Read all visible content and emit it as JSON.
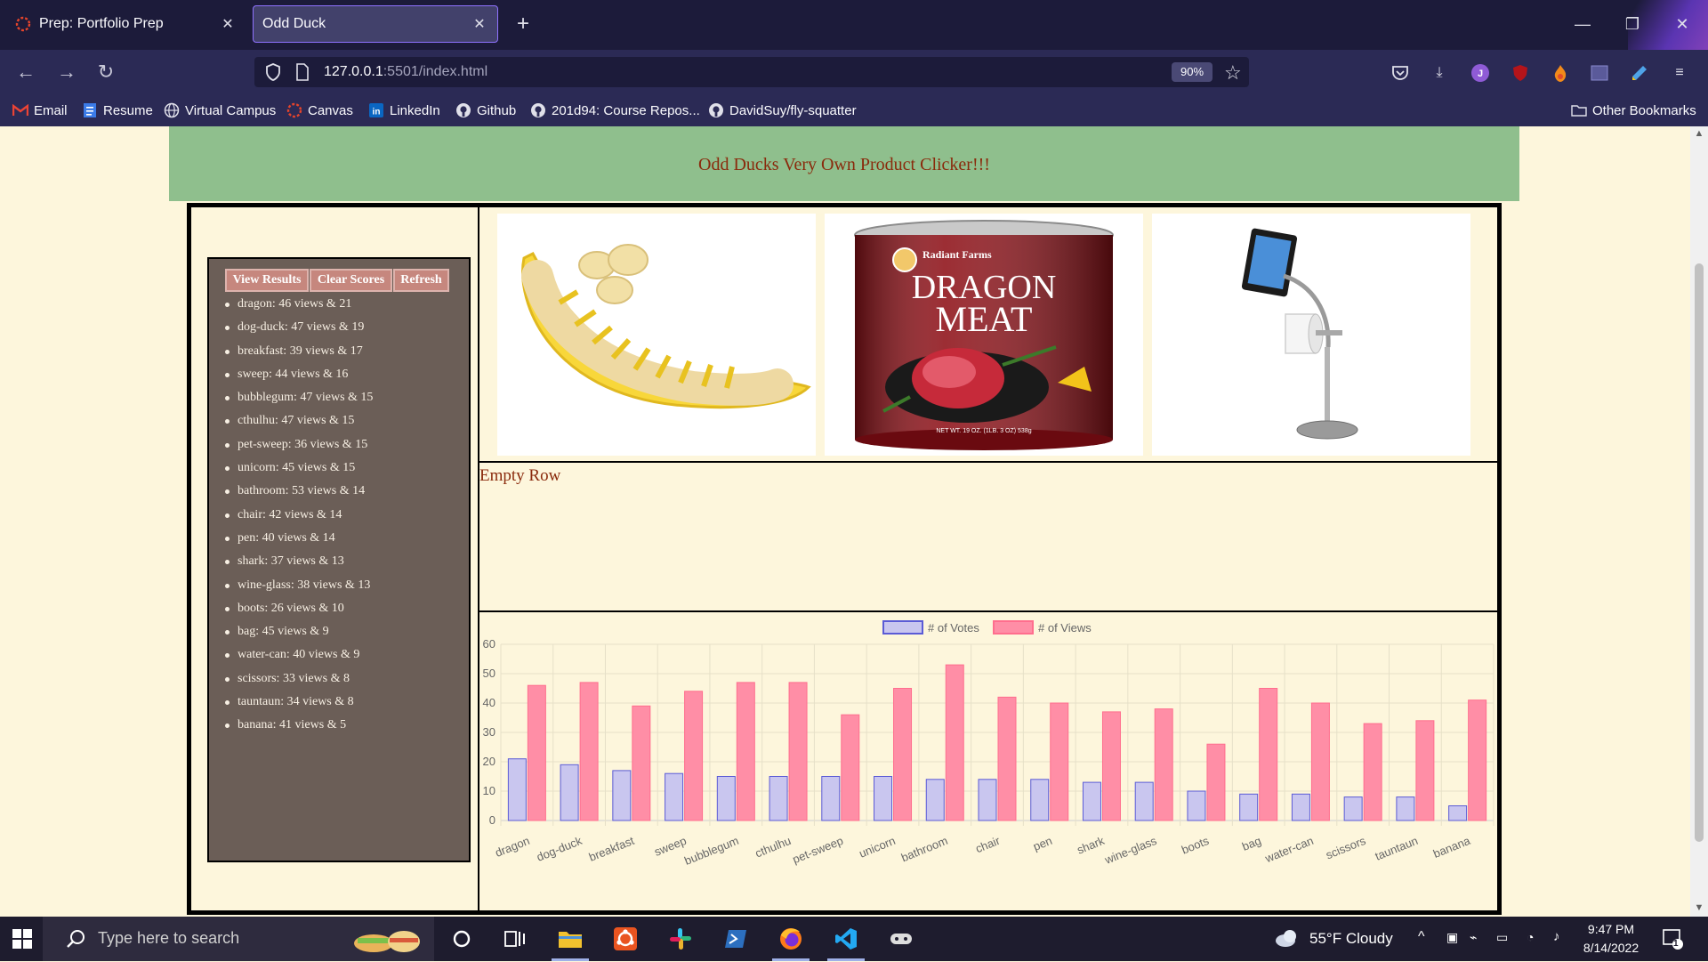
{
  "browser": {
    "tabs": [
      {
        "title": "Prep: Portfolio Prep",
        "active": false
      },
      {
        "title": "Odd Duck",
        "active": true
      }
    ],
    "url": {
      "host": "127.0.0.1",
      "path": ":5501/index.html"
    },
    "zoom": "90%",
    "bookmarks": [
      "Email",
      "Resume",
      "Virtual Campus",
      "Canvas",
      "LinkedIn",
      "Github",
      "201d94: Course Repos...",
      "DavidSuy/fly-squatter"
    ],
    "other_bookmarks": "Other Bookmarks",
    "colors": {
      "tabbar": "#1c1b3a",
      "toolbar": "#2b2a55",
      "accent": "#8f72ff"
    }
  },
  "page": {
    "banner_title": "Odd Ducks Very Own Product Clicker!!!",
    "buttons": {
      "view_results": "View Results",
      "clear_scores": "Clear Scores",
      "refresh": "Refresh"
    },
    "scores": [
      "dragon: 46 views & 21",
      "dog-duck: 47 views & 19",
      "breakfast: 39 views & 17",
      "sweep: 44 views & 16",
      "bubblegum: 47 views & 15",
      "cthulhu: 47 views & 15",
      "pet-sweep: 36 views & 15",
      "unicorn: 45 views & 15",
      "bathroom: 53 views & 14",
      "chair: 42 views & 14",
      "pen: 40 views & 14",
      "shark: 37 views & 13",
      "wine-glass: 38 views & 13",
      "boots: 26 views & 10",
      "bag: 45 views & 9",
      "water-can: 40 views & 9",
      "scissors: 33 views & 8",
      "tauntaun: 34 views & 8",
      "banana: 41 views & 5"
    ],
    "products": [
      {
        "name": "banana",
        "icon": "banana-slicer-image"
      },
      {
        "name": "dragon",
        "label_line1": "DRAGON",
        "label_line2": "MEAT",
        "brand": "Radiant Farms",
        "net_wt": "NET WT. 19 OZ. (1LB. 3 OZ) 538g"
      },
      {
        "name": "bathroom",
        "icon": "tablet-toilet-paper-stand-image"
      }
    ],
    "empty_row_text": "Empty Row",
    "colors": {
      "banner": "#8fbf8d",
      "title_text": "#8a2a0c",
      "sidebar": "#6b5e57",
      "button": "#c6877e",
      "background": "#fdf6dc"
    }
  },
  "chart_data": {
    "type": "bar",
    "categories": [
      "dragon",
      "dog-duck",
      "breakfast",
      "sweep",
      "bubblegum",
      "cthulhu",
      "pet-sweep",
      "unicorn",
      "bathroom",
      "chair",
      "pen",
      "shark",
      "wine-glass",
      "boots",
      "bag",
      "water-can",
      "scissors",
      "tauntaun",
      "banana"
    ],
    "series": [
      {
        "name": "# of Votes",
        "values": [
          21,
          19,
          17,
          16,
          15,
          15,
          15,
          15,
          14,
          14,
          14,
          13,
          13,
          10,
          9,
          9,
          8,
          8,
          5
        ],
        "color": "#c9c6ef",
        "border": "#5b5bd6"
      },
      {
        "name": "# of Views",
        "values": [
          46,
          47,
          39,
          44,
          47,
          47,
          36,
          45,
          53,
          42,
          40,
          37,
          38,
          26,
          45,
          40,
          33,
          34,
          41
        ],
        "color": "#ff8ea6",
        "border": "#ff6e8e"
      }
    ],
    "yticks": [
      "0",
      "10",
      "20",
      "30",
      "40",
      "50",
      "60"
    ],
    "ylim": [
      0,
      60
    ],
    "legend": "top-center",
    "grid": true
  },
  "taskbar": {
    "search_placeholder": "Type here to search",
    "weather": "55°F  Cloudy",
    "time": "9:47 PM",
    "date": "8/14/2022",
    "notifications": "1"
  }
}
